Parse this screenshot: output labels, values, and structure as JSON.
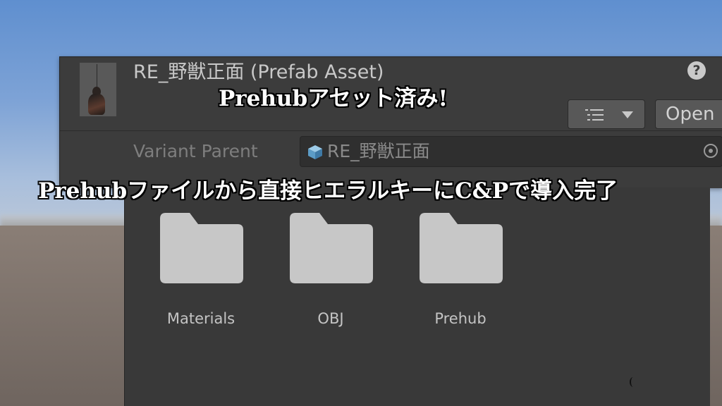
{
  "inspector": {
    "title": "RE_野獣正面 (Prefab Asset)",
    "help_icon": "?",
    "open_button_label": "Open",
    "variant_parent_label": "Variant Parent",
    "variant_parent_value": "RE_野獣正面"
  },
  "folders": [
    {
      "label": "Materials"
    },
    {
      "label": "OBJ"
    },
    {
      "label": "Prehub"
    }
  ],
  "captions": {
    "top": "Prehubアセット済み!",
    "main": "Prehubファイルから直接ヒエラルキーにC&Pで導入完了"
  },
  "colors": {
    "panel": "#3c3c3c",
    "folder": "#c7c7c7",
    "caption_text": "#ffffff",
    "caption_outline": "#000000"
  },
  "icons": [
    "help-icon",
    "list-icon",
    "chevron-down-icon",
    "prefab-icon",
    "target-icon",
    "folder-icon"
  ]
}
